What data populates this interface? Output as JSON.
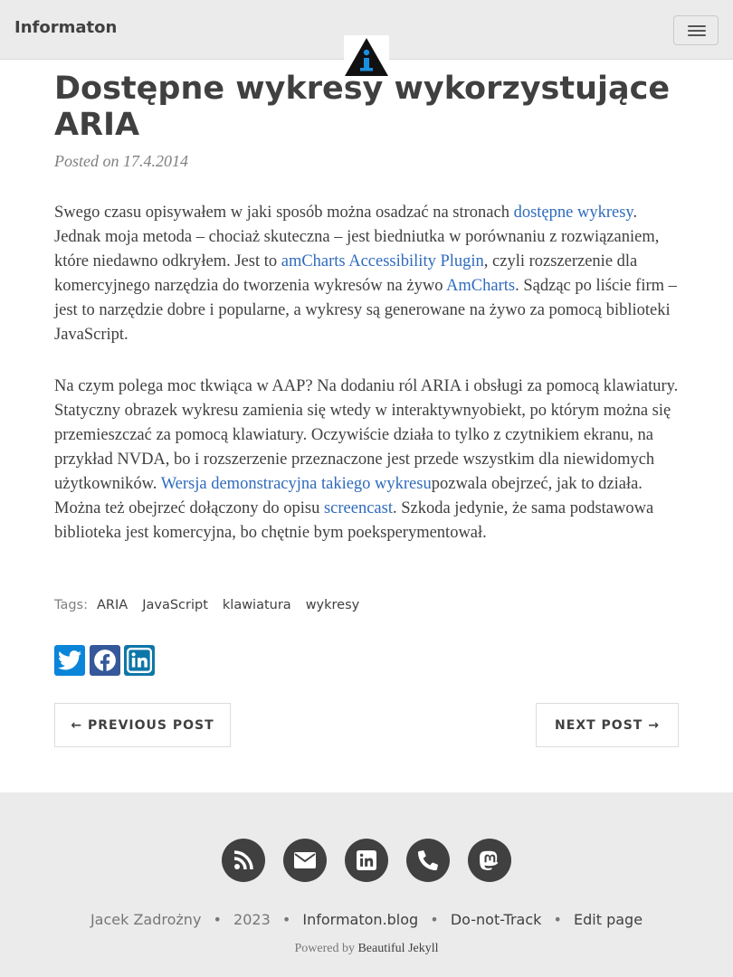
{
  "navbar": {
    "brand": "Informaton",
    "menu_icon": "hamburger-icon",
    "logo_icon": "info-triangle-logo"
  },
  "post": {
    "title": "Dostępne wykresy wykorzystujące ARIA",
    "posted_prefix": "Posted on ",
    "date": "17.4.2014",
    "p1": [
      {
        "text": "Swego czasu opisywałem w jaki sposób można osadzać na stronach "
      },
      {
        "text": "dostępne wykresy",
        "link": true
      },
      {
        "text": ". Jednak moja metoda – chociaż skuteczna – jest biedniutka w porównaniu z rozwiązaniem, które niedawno odkryłem. Jest to "
      },
      {
        "text": "amCharts Accessibility Plugin",
        "link": true
      },
      {
        "text": ", czyli rozszerzenie dla komercyjnego narzędzia do tworzenia wykresów na żywo "
      },
      {
        "text": "AmCharts",
        "link": true
      },
      {
        "text": ". Sądząc po liście firm – jest to narzędzie dobre i popularne, a wykresy są generowane na żywo za pomocą biblioteki JavaScript."
      }
    ],
    "p2": [
      {
        "text": "Na czym polega moc tkwiąca w AAP? Na dodaniu ról ARIA i obsługi za pomocą klawiatury. Statyczny obrazek wykresu zamienia się wtedy w interaktywnyobiekt, po którym można się przemieszczać za pomocą klawiatury. Oczywiście działa to tylko z czytnikiem ekranu, na przykład NVDA, bo i rozszerzenie przeznaczone jest przede wszystkim dla niewidomych użytkowników. "
      },
      {
        "text": "Wersja demonstracyjna takiego wykresu",
        "link": true
      },
      {
        "text": "pozwala obejrzeć, jak to działa. Można też obejrzeć dołączony do opisu "
      },
      {
        "text": "screencast",
        "link": true
      },
      {
        "text": ". Szkoda jedynie, że sama podstawowa biblioteka jest komercyjna, bo chętnie bym poeksperymentował."
      }
    ],
    "tags_label": "Tags:",
    "tags": [
      "ARIA",
      "JavaScript",
      "klawiatura",
      "wykresy"
    ],
    "share": [
      {
        "name": "twitter-icon",
        "color": "#0a85d9"
      },
      {
        "name": "facebook-icon",
        "color": "#35589a"
      },
      {
        "name": "linkedin-icon",
        "color": "#0e76a8"
      }
    ],
    "prev_label": "← PREVIOUS POST",
    "next_label": "NEXT POST →"
  },
  "footer": {
    "social": [
      "rss-icon",
      "envelope-icon",
      "linkedin-icon",
      "phone-icon",
      "mastodon-icon"
    ],
    "author": "Jacek Zadrożny",
    "year": "2023",
    "site": "Informaton.blog",
    "dnt": "Do-not-Track",
    "edit": "Edit page",
    "separator": "•",
    "powered_by": "Powered by ",
    "powered_name": "Beautiful Jekyll"
  },
  "colors": {
    "link": "#2f6bbd",
    "text": "#404040",
    "muted": "#808080",
    "navbar_bg": "#ebebeb",
    "footer_bg": "#ebebeb"
  }
}
